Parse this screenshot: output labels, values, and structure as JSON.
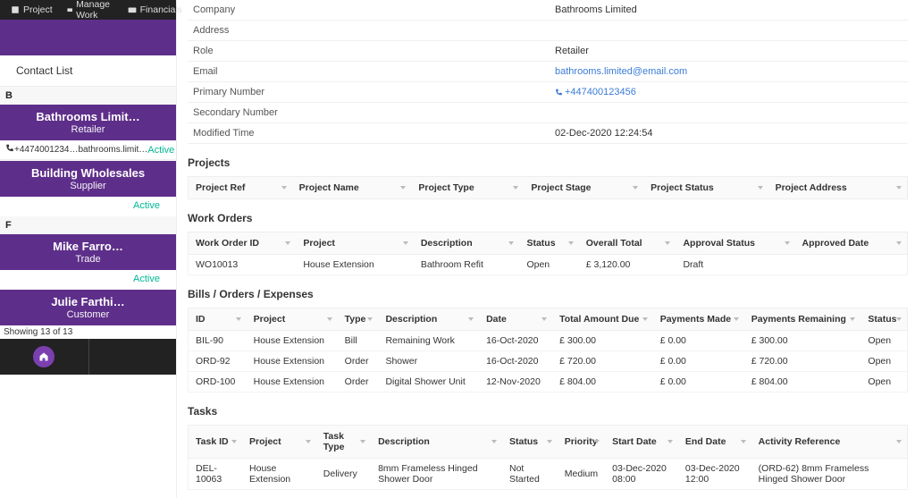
{
  "nav": {
    "project": "Project",
    "manage": "Manage Work",
    "fin": "Financials"
  },
  "contact_list_label": "Contact List",
  "alpha": {
    "b": "B",
    "f": "F"
  },
  "cards": [
    {
      "title": "Bathrooms Limit…",
      "sub": "Retailer",
      "phone": "+4474001234…",
      "email": "bathrooms.limit…",
      "status": "Active"
    },
    {
      "title": "Building Wholesales",
      "sub": "Supplier",
      "status": "Active"
    },
    {
      "title": "Mike Farro…",
      "sub": "Trade",
      "status": "Active"
    },
    {
      "title": "Julie Farthi…",
      "sub": "Customer"
    }
  ],
  "showing": "Showing 13 of 13",
  "details": {
    "company_k": "Company",
    "company_v": "Bathrooms Limited",
    "address_k": "Address",
    "address_v": "",
    "role_k": "Role",
    "role_v": "Retailer",
    "email_k": "Email",
    "email_v": "bathrooms.limited@email.com",
    "primary_k": "Primary Number",
    "primary_v": "+447400123456",
    "secondary_k": "Secondary Number",
    "secondary_v": "",
    "modified_k": "Modified Time",
    "modified_v": "02-Dec-2020 12:24:54"
  },
  "sections": {
    "projects": "Projects",
    "work_orders": "Work Orders",
    "boe": "Bills / Orders / Expenses",
    "tasks": "Tasks"
  },
  "projects_cols": {
    "ref": "Project Ref",
    "name": "Project Name",
    "type": "Project Type",
    "stage": "Project Stage",
    "status": "Project Status",
    "addr": "Project Address"
  },
  "wo_cols": {
    "id": "Work Order ID",
    "project": "Project",
    "desc": "Description",
    "status": "Status",
    "total": "Overall Total",
    "approval": "Approval Status",
    "approved": "Approved Date"
  },
  "wo_rows": [
    {
      "id": "WO10013",
      "project": "House Extension",
      "desc": "Bathroom Refit",
      "status": "Open",
      "total": "£ 3,120.00",
      "approval": "Draft",
      "approved": ""
    }
  ],
  "boe_cols": {
    "id": "ID",
    "project": "Project",
    "type": "Type",
    "desc": "Description",
    "date": "Date",
    "due": "Total Amount Due",
    "paid": "Payments Made",
    "remain": "Payments Remaining",
    "status": "Status"
  },
  "boe_rows": [
    {
      "id": "BIL-90",
      "project": "House Extension",
      "type": "Bill",
      "desc": "Remaining Work",
      "date": "16-Oct-2020",
      "due": "£ 300.00",
      "paid": "£ 0.00",
      "remain": "£ 300.00",
      "status": "Open"
    },
    {
      "id": "ORD-92",
      "project": "House Extension",
      "type": "Order",
      "desc": "Shower",
      "date": "16-Oct-2020",
      "due": "£ 720.00",
      "paid": "£ 0.00",
      "remain": "£ 720.00",
      "status": "Open"
    },
    {
      "id": "ORD-100",
      "project": "House Extension",
      "type": "Order",
      "desc": "Digital Shower Unit",
      "date": "12-Nov-2020",
      "due": "£ 804.00",
      "paid": "£ 0.00",
      "remain": "£ 804.00",
      "status": "Open"
    }
  ],
  "tasks_cols": {
    "id": "Task ID",
    "project": "Project",
    "type": "Task Type",
    "desc": "Description",
    "status": "Status",
    "priority": "Priority",
    "start": "Start Date",
    "end": "End Date",
    "ref": "Activity Reference"
  },
  "tasks_rows": [
    {
      "id": "DEL-10063",
      "project": "House Extension",
      "type": "Delivery",
      "desc": "8mm Frameless Hinged Shower Door",
      "status": "Not Started",
      "priority": "Medium",
      "start": "03-Dec-2020 08:00",
      "end": "03-Dec-2020 12:00",
      "ref": "(ORD-62) 8mm Frameless Hinged Shower Door"
    }
  ]
}
